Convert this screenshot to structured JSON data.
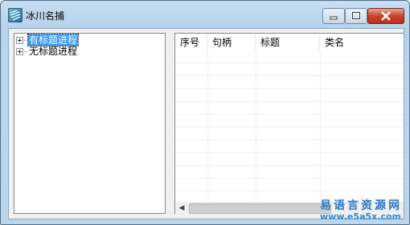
{
  "window": {
    "title": "冰川名捕"
  },
  "tree": {
    "nodes": [
      {
        "label": "有标题进程",
        "selected": true
      },
      {
        "label": "无标题进程",
        "selected": false
      }
    ]
  },
  "list": {
    "columns": [
      "序号",
      "句柄",
      "标题",
      "类名"
    ],
    "rows": []
  },
  "watermark": {
    "line1": "易语言资源网",
    "line2": "www.e5a5x.com"
  },
  "colors": {
    "selection": "#3399ff",
    "close_button": "#c8432a",
    "watermark": "#2a77c7"
  }
}
